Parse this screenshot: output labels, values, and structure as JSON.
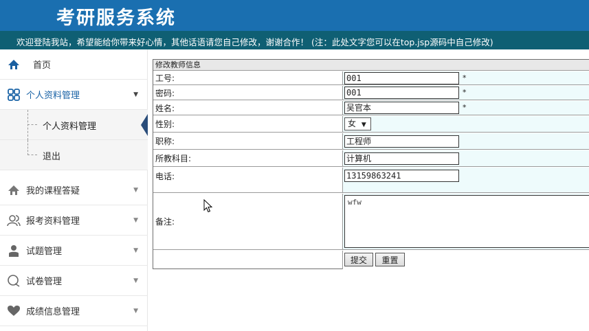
{
  "header": {
    "title": "考研服务系统",
    "notice": "欢迎登陆我站，希望能给你带来好心情，其他话语请您自己修改，谢谢合作！    (注：此处文字您可以在top.jsp源码中自己修改)",
    "bg_color": "#1a6fb0",
    "notice_bg_color": "#0f5f73"
  },
  "sidebar": {
    "items": [
      {
        "label": "首页",
        "icon": "home-icon"
      },
      {
        "label": "个人资料管理",
        "icon": "grid-icon",
        "expanded": true,
        "children": [
          {
            "label": "个人资料管理",
            "active": true
          },
          {
            "label": "退出"
          }
        ]
      },
      {
        "label": "我的课程答疑",
        "icon": "home-icon"
      },
      {
        "label": "报考资料管理",
        "icon": "users-icon"
      },
      {
        "label": "试题管理",
        "icon": "user-icon"
      },
      {
        "label": "试卷管理",
        "icon": "chat-icon"
      },
      {
        "label": "成绩信息管理",
        "icon": "heart-icon"
      }
    ],
    "accent_color": "#1a63a6"
  },
  "form": {
    "title": "修改教师信息",
    "fields": {
      "id": {
        "label": "工号:",
        "value": "001",
        "required": "*"
      },
      "password": {
        "label": "密码:",
        "value": "001",
        "required": "*"
      },
      "name": {
        "label": "姓名:",
        "value": "吴官本",
        "required": "*"
      },
      "gender": {
        "label": "性别:",
        "value": "女"
      },
      "title": {
        "label": "职称:",
        "value": "工程师"
      },
      "subject": {
        "label": "所教科目:",
        "value": "计算机"
      },
      "phone": {
        "label": "电话:",
        "value": "13159863241"
      },
      "remark": {
        "label": "备注:",
        "value": "wfw"
      }
    },
    "submit_label": "提交",
    "reset_label": "重置",
    "value_bg_color": "#eefbfc"
  }
}
